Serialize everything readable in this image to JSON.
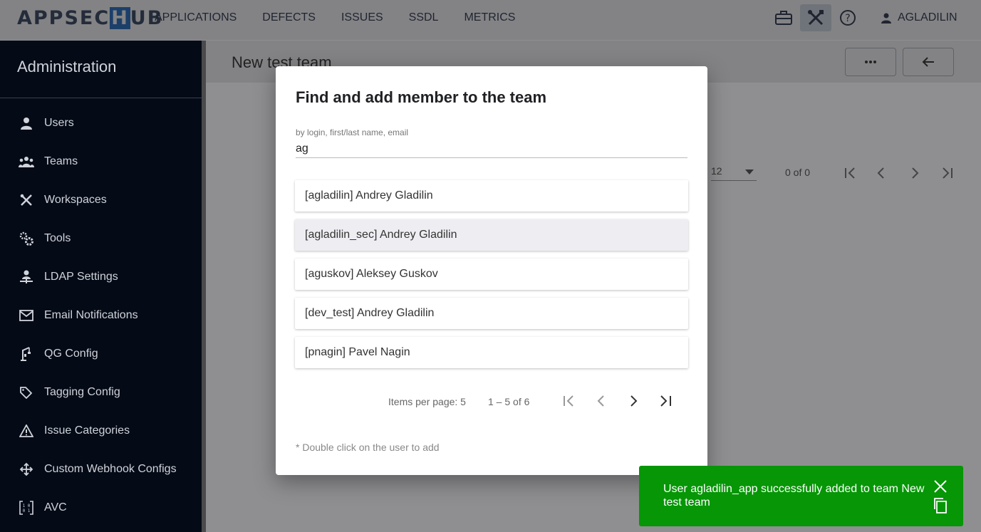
{
  "app": {
    "logo_left": "APPSEC",
    "logo_hu": "H",
    "logo_right": "UB",
    "nav": [
      "APPLICATIONS",
      "DEFECTS",
      "ISSUES",
      "SSDL",
      "METRICS"
    ],
    "top_icons": [
      "briefcase-icon",
      "tools-icon",
      "help-icon"
    ],
    "user": "AGLADILIN"
  },
  "sidebar": {
    "title": "Administration",
    "items": [
      {
        "label": "Users",
        "icon": "person-icon"
      },
      {
        "label": "Teams",
        "icon": "group-icon"
      },
      {
        "label": "Workspaces",
        "icon": "tools-icon"
      },
      {
        "label": "Tools",
        "icon": "gears-icon"
      },
      {
        "label": "LDAP Settings",
        "icon": "ldap-person-icon"
      },
      {
        "label": "Email Notifications",
        "icon": "mail-icon"
      },
      {
        "label": "QG Config",
        "icon": "crane-icon"
      },
      {
        "label": "Tagging Config",
        "icon": "tags-icon"
      },
      {
        "label": "Issue Categories",
        "icon": "warning-icon"
      },
      {
        "label": "Custom Webhook Configs",
        "icon": "webhook-icon"
      },
      {
        "label": "AVC",
        "icon": "binary-icon"
      }
    ]
  },
  "main": {
    "title": "New test team",
    "page_size": "12",
    "range": "0 of 0"
  },
  "dialog": {
    "title": "Find and add member to the team",
    "field_label": "by login, first/last name, email",
    "field_value": "ag",
    "results": [
      "[agladilin] Andrey Gladilin",
      "[agladilin_sec] Andrey Gladilin",
      "[aguskov] Aleksey Guskov",
      "[dev_test] Andrey Gladilin",
      "[pnagin] Pavel Nagin"
    ],
    "highlighted_index": 1,
    "items_per_page_label": "Items per page:",
    "items_per_page": "5",
    "range": "1 – 5 of 6",
    "hint": "* Double click on the user to add"
  },
  "snackbar": {
    "message": "User agladilin_app successfully added to team New test team"
  },
  "colors": {
    "sidebar_bg": "#040a16",
    "snackbar_bg": "#069606",
    "dim_bg": "#8f8f91"
  }
}
